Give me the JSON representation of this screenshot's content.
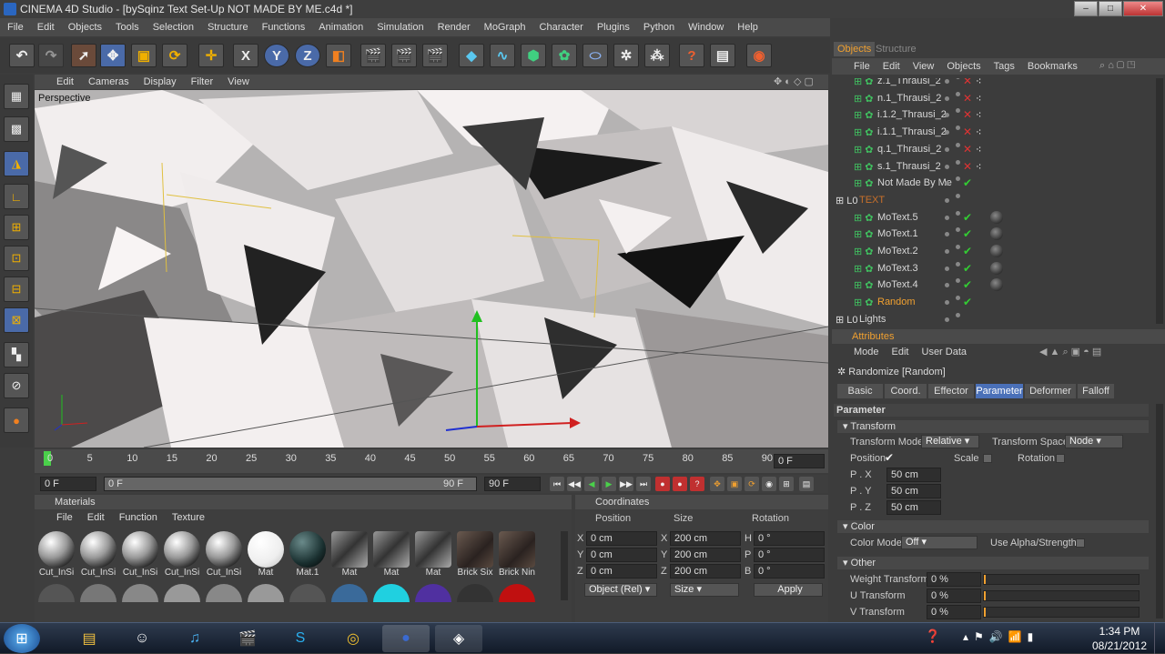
{
  "window": {
    "title": "CINEMA 4D Studio - [bySqinz Text Set-Up NOT MADE BY ME.c4d *]",
    "minimize": "–",
    "maximize": "□",
    "close": "✕"
  },
  "menubar": [
    "File",
    "Edit",
    "Objects",
    "Tools",
    "Selection",
    "Structure",
    "Functions",
    "Animation",
    "Simulation",
    "Render",
    "MoGraph",
    "Character",
    "Plugins",
    "Python",
    "Window",
    "Help"
  ],
  "toolbar": {
    "x_label": "X",
    "y_label": "Y",
    "z_label": "Z"
  },
  "viewport": {
    "menu": [
      "Edit",
      "Cameras",
      "Display",
      "Filter",
      "View"
    ],
    "label": "Perspective"
  },
  "timeline": {
    "ticks": [
      "0",
      "5",
      "10",
      "15",
      "20",
      "25",
      "30",
      "35",
      "40",
      "45",
      "50",
      "55",
      "60",
      "65",
      "70",
      "75",
      "80",
      "85",
      "90"
    ],
    "end_frame": "0 F"
  },
  "transport": {
    "start": "0 F",
    "slider_start": "0 F",
    "slider_end": "90 F",
    "end": "90 F"
  },
  "materials": {
    "title": "Materials",
    "menu": [
      "File",
      "Edit",
      "Function",
      "Texture"
    ],
    "items": [
      {
        "label": "Cut_InSi"
      },
      {
        "label": "Cut_InSi"
      },
      {
        "label": "Cut_InSi"
      },
      {
        "label": "Cut_InSi"
      },
      {
        "label": "Cut_InSi"
      },
      {
        "label": "Mat"
      },
      {
        "label": "Mat.1"
      },
      {
        "label": "Mat"
      },
      {
        "label": "Mat"
      },
      {
        "label": "Mat"
      },
      {
        "label": "Brick Six"
      },
      {
        "label": "Brick Nin"
      }
    ]
  },
  "coordinates": {
    "title": "Coordinates",
    "headers": [
      "Position",
      "Size",
      "Rotation"
    ],
    "rows": [
      {
        "axis": "X",
        "pos": "0 cm",
        "size_axis": "X",
        "size": "200 cm",
        "rot_axis": "H",
        "rot": "0 °"
      },
      {
        "axis": "Y",
        "pos": "0 cm",
        "size_axis": "Y",
        "size": "200 cm",
        "rot_axis": "P",
        "rot": "0 °"
      },
      {
        "axis": "Z",
        "pos": "0 cm",
        "size_axis": "Z",
        "size": "200 cm",
        "rot_axis": "B",
        "rot": "0 °"
      }
    ],
    "mode": "Object (Rel)",
    "size_mode": "Size",
    "apply": "Apply"
  },
  "objects": {
    "tabs": [
      "Objects",
      "Structure"
    ],
    "menu": [
      "File",
      "Edit",
      "View",
      "Objects",
      "Tags",
      "Bookmarks"
    ],
    "rows": [
      {
        "name": "z.1_Thrausi_2",
        "color": "#d8d8d8",
        "x": true
      },
      {
        "name": "n.1_Thrausi_2",
        "color": "#d8d8d8",
        "x": true
      },
      {
        "name": "i.1.2_Thrausi_2",
        "color": "#d8d8d8",
        "x": true
      },
      {
        "name": "i.1.1_Thrausi_2",
        "color": "#d8d8d8",
        "x": true
      },
      {
        "name": "q.1_Thrausi_2",
        "color": "#d8d8d8",
        "x": true
      },
      {
        "name": "s.1_Thrausi_2",
        "color": "#d8d8d8",
        "x": true
      },
      {
        "name": "Not Made By Me",
        "color": "#d8d8d8",
        "x": false
      },
      {
        "name": "TEXT",
        "color": "#c8702a",
        "x": false
      },
      {
        "name": "MoText.5",
        "color": "#d8d8d8",
        "x": false
      },
      {
        "name": "MoText.1",
        "color": "#d8d8d8",
        "x": false
      },
      {
        "name": "MoText.2",
        "color": "#d8d8d8",
        "x": false
      },
      {
        "name": "MoText.3",
        "color": "#d8d8d8",
        "x": false
      },
      {
        "name": "MoText.4",
        "color": "#d8d8d8",
        "x": false
      },
      {
        "name": "Random",
        "color": "#f0a030",
        "x": false
      },
      {
        "name": "Lights",
        "color": "#d8d8d8",
        "x": false
      }
    ]
  },
  "attributes": {
    "title": "Attributes",
    "menu": [
      "Mode",
      "Edit",
      "User Data"
    ],
    "object_name": "Randomize [Random]",
    "tabs": [
      "Basic",
      "Coord.",
      "Effector",
      "Parameter",
      "Deformer",
      "Falloff"
    ],
    "active_tab": "Parameter",
    "section": "Parameter",
    "transform": {
      "header": "Transform",
      "mode_label": "Transform Mode",
      "mode_value": "Relative",
      "space_label": "Transform Space",
      "space_value": "Node",
      "position": "Position",
      "scale": "Scale",
      "rotation": "Rotation",
      "px_label": "P . X",
      "px": "50 cm",
      "py_label": "P . Y",
      "py": "50 cm",
      "pz_label": "P . Z",
      "pz": "50 cm"
    },
    "color": {
      "header": "Color",
      "mode_label": "Color Mode",
      "mode_value": "Off",
      "alpha_label": "Use Alpha/Strength"
    },
    "other": {
      "header": "Other",
      "weight_label": "Weight Transform",
      "weight": "0 %",
      "u_label": "U Transform",
      "u": "0 %",
      "v_label": "V Transform",
      "v": "0 %"
    }
  },
  "taskbar": {
    "time": "1:34 PM",
    "date": "08/21/2012"
  }
}
